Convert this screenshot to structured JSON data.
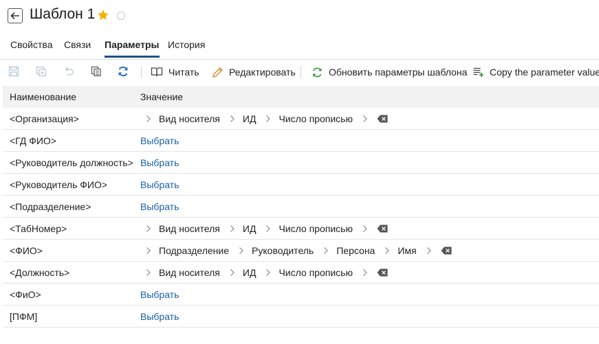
{
  "header": {
    "title": "Шаблон 1"
  },
  "tabs": [
    {
      "label": "Свойства"
    },
    {
      "label": "Связи"
    },
    {
      "label": "Параметры"
    },
    {
      "label": "История"
    }
  ],
  "toolbar": {
    "read_label": "Читать",
    "edit_label": "Редактировать",
    "refresh_params_label": "Обновить параметры шаблона",
    "copy_value_label": "Copy the parameter value"
  },
  "grid": {
    "columns": [
      "Наименование",
      "Значение"
    ],
    "select_label": "Выбрать",
    "rows": [
      {
        "name": "<Организация>",
        "path": [
          "Вид носителя",
          "ИД",
          "Число прописью"
        ]
      },
      {
        "name": "<ГД ФИО>",
        "path": []
      },
      {
        "name": "<Руководитель должность>",
        "path": []
      },
      {
        "name": "<Руководитель ФИО>",
        "path": []
      },
      {
        "name": "<Подразделение>",
        "path": []
      },
      {
        "name": "<ТабНомер>",
        "path": [
          "Вид носителя",
          "ИД",
          "Число прописью"
        ]
      },
      {
        "name": "<ФИО>",
        "path": [
          "Подразделение",
          "Руководитель",
          "Персона",
          "Имя"
        ]
      },
      {
        "name": "<Должность>",
        "path": [
          "Вид носителя",
          "ИД",
          "Число прописью"
        ]
      },
      {
        "name": "<ФиО>",
        "path": []
      },
      {
        "name": "[ПФМ]",
        "path": []
      }
    ]
  },
  "colors": {
    "accent": "#1f4f8a",
    "link": "#1a5fa8",
    "star": "#f0b400",
    "refresh_green": "#3a9a3a",
    "sync_blue": "#2a6fbf"
  },
  "icons": [
    "back-arrow-icon",
    "star-icon",
    "status-circle-icon",
    "save-icon",
    "save-as-icon",
    "undo-icon",
    "copy-icon",
    "refresh-icon",
    "book-icon",
    "pencil-icon",
    "refresh-params-icon",
    "copy-param-icon",
    "chevron-right-icon",
    "clear-icon"
  ]
}
